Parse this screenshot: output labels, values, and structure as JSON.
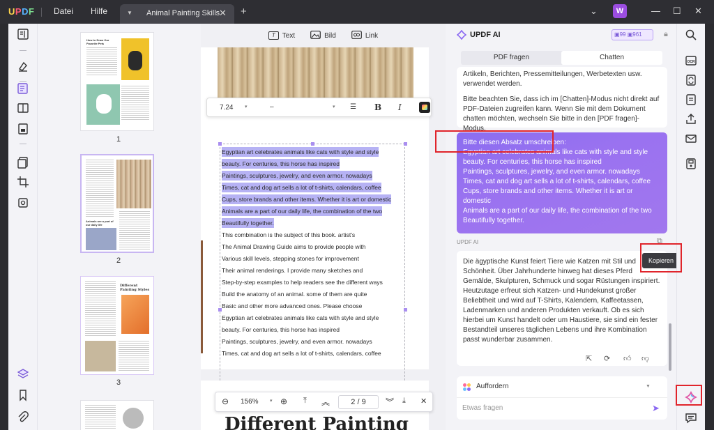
{
  "app": {
    "logo": "UPDF",
    "menu": [
      "Datei",
      "Hilfe"
    ],
    "tab_title": "Animal Painting Skills",
    "user_initial": "W"
  },
  "toolbar": {
    "text": "Text",
    "image": "Bild",
    "link": "Link"
  },
  "thumbnails": [
    {
      "page": "1"
    },
    {
      "page": "2"
    },
    {
      "page": "3"
    }
  ],
  "format_bar": {
    "font_size": "7.24",
    "font_name": "–"
  },
  "document": {
    "lines": [
      "Egyptian art celebrates animals like cats with style and style",
      "beauty. For centuries, this horse has inspired",
      "Paintings, sculptures, jewelry, and even armor. nowadays",
      "Times, cat and dog art sells a lot of t-shirts, calendars, coffee",
      "Cups, store brands and other items. Whether it is art or domestic",
      "Animals are a part of our daily life, the combination of the two",
      "Beautifully together.",
      "This combination is the subject of this book. artist's",
      "The Animal Drawing Guide aims to provide people with",
      "Various skill levels, stepping stones for improvement",
      "Their animal renderings. I provide many sketches and",
      "Step-by-step examples to help readers see the different ways",
      "Build the anatomy of an animal. some of them are quite",
      "Basic and other more advanced ones. Please choose",
      "Egyptian art celebrates animals like cats with style and style",
      "beauty. For centuries, this horse has inspired",
      "Paintings, sculptures, jewelry, and even armor. nowadays",
      "Times, cat and dog art sells a lot of t-shirts, calendars, coffee"
    ],
    "next_page_heading": "Different Painting"
  },
  "pager": {
    "zoom": "156%",
    "current_page": "2",
    "total_pages": "9",
    "page_display": "2 / 9"
  },
  "ai": {
    "title": "UPDF AI",
    "credits_a": "99",
    "credits_b": "961",
    "tab_pdf": "PDF fragen",
    "tab_chat": "Chatten",
    "info_text": "Artikeln, Berichten, Pressemitteilungen, Werbetexten usw. verwendet werden.",
    "info_text2": "Bitte beachten Sie, dass ich im [Chatten]-Modus nicht direkt auf PDF-Dateien zugreifen kann. Wenn Sie mit dem Dokument chatten möchten, wechseln Sie bitte in den [PDF fragen]-Modus.",
    "user_message": "Bitte diesen Absatz umschreiben:\nEgyptian art celebrates animals like cats with style and style\nbeauty. For centuries, this horse has inspired\nPaintings, sculptures, jewelry, and even armor. nowadays\nTimes, cat and dog art sells a lot of t-shirts, calendars, coffee\nCups, store brands and other items. Whether it is art or domestic\nAnimals are a part of our daily life, the combination of the two\nBeautifully together.",
    "sender": "UPDF AI",
    "answer": "Die ägyptische Kunst feiert Tiere wie Katzen mit Stil und Schönheit. Über Jahrhunderte hinweg hat dieses Pferd Gemälde, Skulpturen, Schmuck und sogar Rüstungen inspiriert. Heutzutage erfreut sich Katzen- und Hundekunst großer Beliebtheit und wird auf T-Shirts, Kalendern, Kaffeetassen, Ladenmarken und anderen Produkten verkauft. Ob es sich hierbei um Kunst handelt oder um Haustiere, sie sind ein fester Bestandteil unseres täglichen Lebens und ihre Kombination passt wunderbar zusammen.",
    "tooltip": "Kopieren",
    "prompt_mode": "Auffordern",
    "prompt_placeholder": "Etwas fragen"
  },
  "colors": {
    "accent": "#8b6df0",
    "highlight": "#b6b2f4",
    "annotation": "#e0242b"
  }
}
